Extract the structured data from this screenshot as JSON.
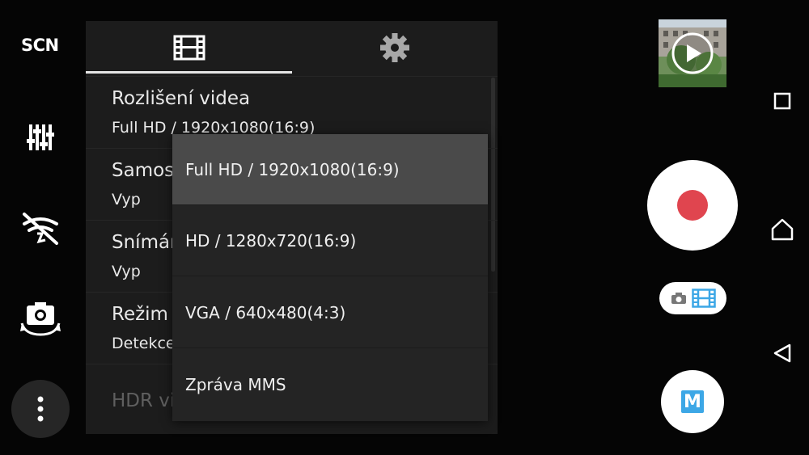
{
  "left_rail": {
    "scene_label": "SCN",
    "icons": [
      "equalizer-icon",
      "no-flash-icon",
      "switch-camera-icon",
      "more-vert-icon"
    ]
  },
  "settings_panel": {
    "tabs": [
      {
        "name": "video-settings",
        "icon": "film-icon",
        "active": true
      },
      {
        "name": "general-settings",
        "icon": "gear-icon",
        "active": false
      }
    ],
    "rows": [
      {
        "title": "Rozlišení videa",
        "value": "Full HD / 1920x1080(16:9)"
      },
      {
        "title": "Samospoušť",
        "value": "Vyp"
      },
      {
        "title": "Snímání úsměvu",
        "value": "Vyp"
      },
      {
        "title": "Režim ostření",
        "value": "Detekce obličejů"
      },
      {
        "title": "HDR video",
        "value": ""
      }
    ],
    "hdr_toggle_on": false
  },
  "dropdown": {
    "options": [
      {
        "label": "Full HD / 1920x1080(16:9)",
        "selected": true
      },
      {
        "label": "HD / 1280x720(16:9)",
        "selected": false
      },
      {
        "label": "VGA / 640x480(4:3)",
        "selected": false
      },
      {
        "label": "Zpráva MMS",
        "selected": false
      }
    ]
  },
  "right_controls": {
    "record_color": "#e0454f",
    "mode_switch_accent": "#3ca7e6",
    "manual_label": "M"
  },
  "nav_bar": [
    "recents-icon",
    "home-icon",
    "back-icon"
  ]
}
